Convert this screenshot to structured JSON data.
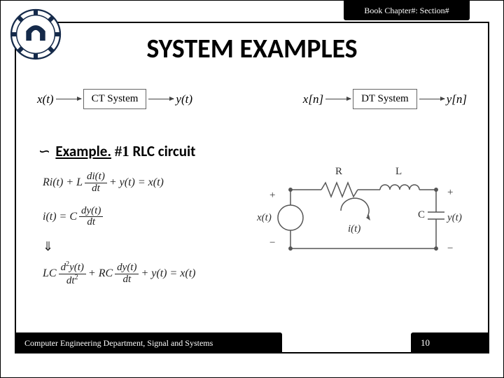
{
  "header": {
    "chapter_label": "Book Chapter#: Section#"
  },
  "title": "SYSTEM EXAMPLES",
  "systems": {
    "ct": {
      "input": "x(t)",
      "label": "CT System",
      "output": "y(t)"
    },
    "dt": {
      "input": "x[n]",
      "label": "DT System",
      "output": "y[n]"
    }
  },
  "example": {
    "bullet": "∽",
    "label": "Example.",
    "num": "#1",
    "name": "RLC circuit"
  },
  "eq": {
    "e1a": "Ri(t) + L",
    "e1_num": "di(t)",
    "e1_den": "dt",
    "e1b": "+ y(t) = x(t)",
    "e2a": "i(t) = C",
    "e2_num": "dy(t)",
    "e2_den": "dt",
    "implies": "⇓",
    "e3a": "LC",
    "e3_num1a": "d",
    "e3_num1b": "y(t)",
    "e3_den1a": "dt",
    "e3b": "+ RC",
    "e3_num2": "dy(t)",
    "e3_den2": "dt",
    "e3c": "+ y(t) = x(t)",
    "sup2": "2"
  },
  "circuit": {
    "R": "R",
    "L": "L",
    "C": "C",
    "x": "x(t)",
    "y": "y(t)",
    "i": "i(t)",
    "plus": "+",
    "minus": "−"
  },
  "footer": {
    "dept": "Computer Engineering Department, Signal and Systems",
    "page": "10"
  }
}
